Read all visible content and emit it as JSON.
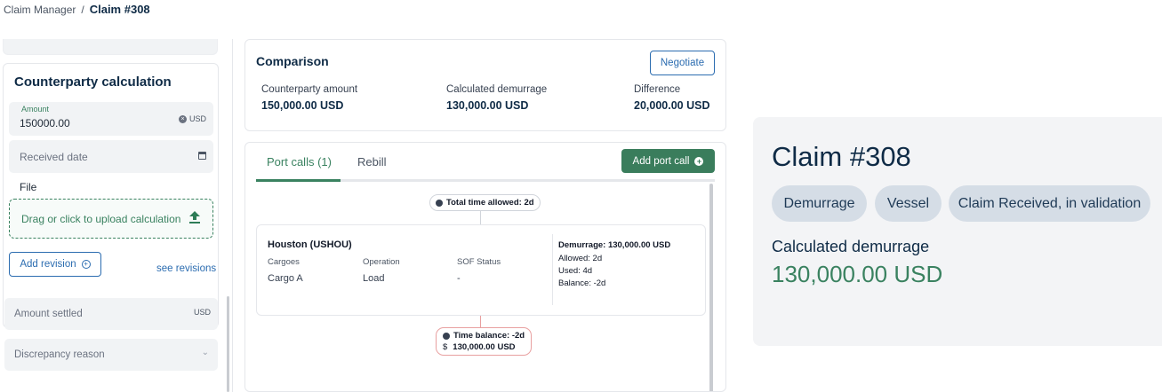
{
  "breadcrumb": {
    "root": "Claim Manager",
    "separator": "/",
    "current": "Claim #308"
  },
  "counterparty": {
    "title": "Counterparty calculation",
    "amount_label": "Amount",
    "amount_value": "150000.00",
    "amount_currency": "USD",
    "received_date_placeholder": "Received date",
    "file_label": "File",
    "upload_text": "Drag or click to upload calculation",
    "add_revision_label": "Add revision",
    "see_revisions_label": "see revisions",
    "amount_settled_placeholder": "Amount settled",
    "amount_settled_currency": "USD",
    "discrepancy_placeholder": "Discrepancy reason"
  },
  "comparison": {
    "title": "Comparison",
    "negotiate_label": "Negotiate",
    "columns": [
      {
        "label": "Counterparty amount",
        "value": "150,000.00 USD"
      },
      {
        "label": "Calculated demurrage",
        "value": "130,000.00 USD"
      },
      {
        "label": "Difference",
        "value": "20,000.00 USD"
      }
    ]
  },
  "port_calls": {
    "tabs": [
      {
        "label": "Port calls (1)"
      },
      {
        "label": "Rebill"
      }
    ],
    "add_button_label": "Add port call",
    "total_time_allowed": "Total time allowed: 2d",
    "port": {
      "name": "Houston (USHOU)",
      "cargoes_label": "Cargoes",
      "cargoes_value": "Cargo A",
      "operation_label": "Operation",
      "operation_value": "Load",
      "sof_label": "SOF Status",
      "sof_value": "-",
      "demurrage": "Demurrage: 130,000.00 USD",
      "allowed": "Allowed: 2d",
      "used": "Used: 4d",
      "balance": "Balance: -2d"
    },
    "time_balance": "Time balance: -2d",
    "balance_amount": "130,000.00 USD",
    "balance_currency_symbol": "$"
  },
  "summary": {
    "title": "Claim #308",
    "badges": [
      "Demurrage",
      "Vessel",
      "Claim Received, in validation"
    ],
    "calc_label": "Calculated demurrage",
    "calc_value": "130,000.00 USD"
  },
  "colors": {
    "accent_green": "#3a8260",
    "link_blue": "#2b6cb0",
    "navy": "#0f2b46",
    "badge_bg": "#d5dde6"
  }
}
